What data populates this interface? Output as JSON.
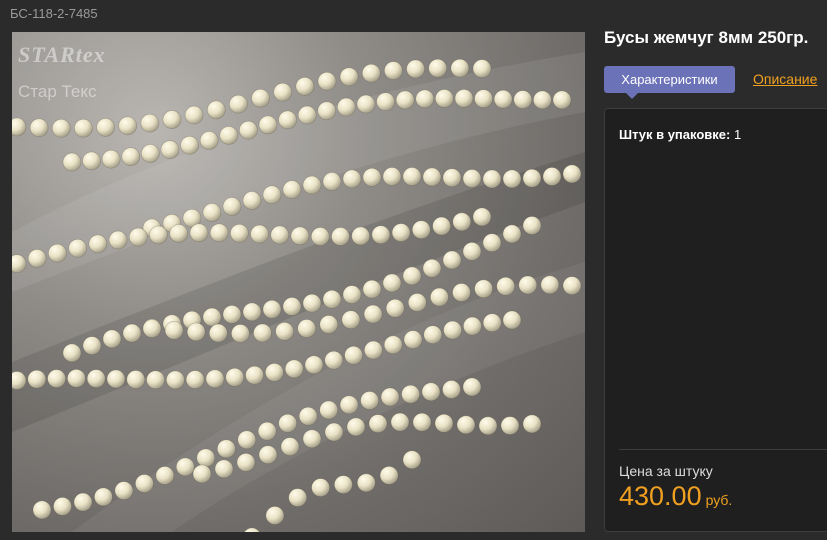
{
  "product": {
    "sku": "БС-118-2-7485",
    "title": "Бусы жемчуг 8мм 250гр.",
    "image_watermark": "STARtex",
    "image_watermark_ru": "Стар Текс"
  },
  "tabs": {
    "active": "Характеристики",
    "link": "Описание"
  },
  "specs": {
    "label": "Штук в упаковке:",
    "value": "1"
  },
  "price": {
    "label": "Цена за штуку",
    "amount": "430.00",
    "currency": "руб."
  },
  "colors": {
    "accent_tab": "#6b72b8",
    "price": "#f0a020",
    "background": "#2b2b2b"
  }
}
